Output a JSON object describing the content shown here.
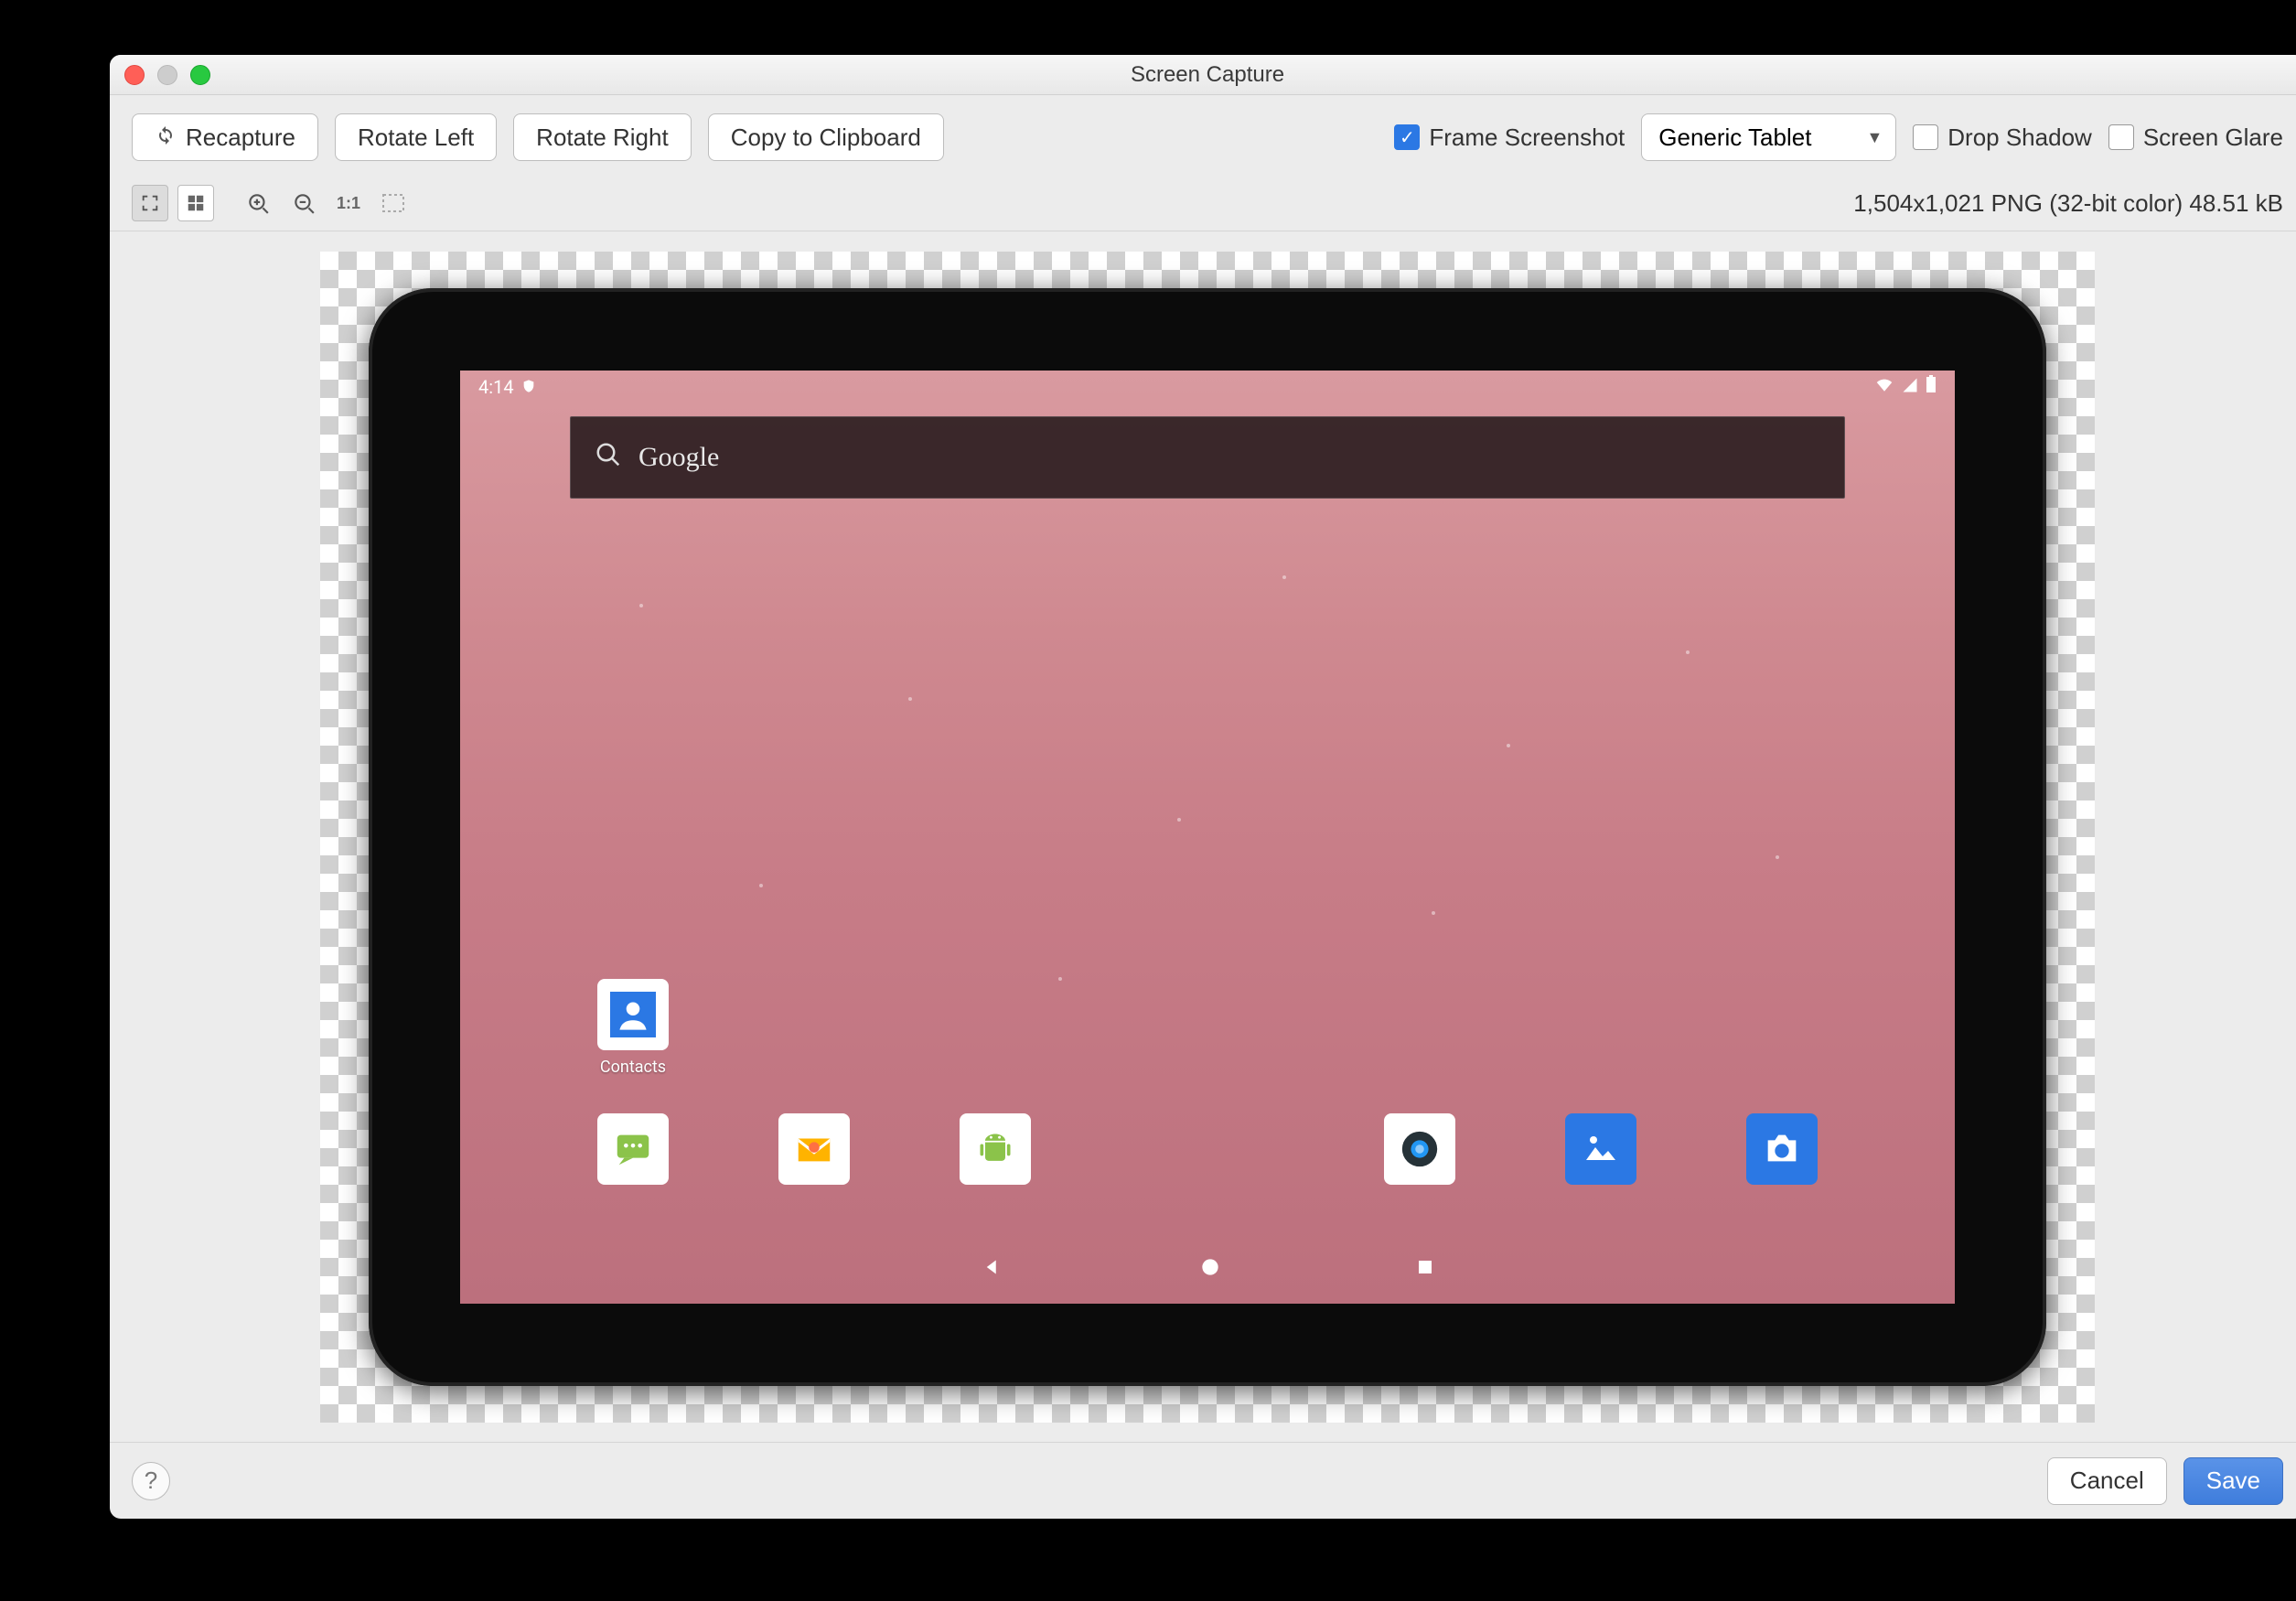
{
  "window": {
    "title": "Screen Capture"
  },
  "toolbar": {
    "recapture": "Recapture",
    "rotate_left": "Rotate Left",
    "rotate_right": "Rotate Right",
    "copy": "Copy to Clipboard",
    "frame_screenshot": "Frame Screenshot",
    "frame_screenshot_checked": true,
    "device_select": "Generic Tablet",
    "drop_shadow": "Drop Shadow",
    "drop_shadow_checked": false,
    "screen_glare": "Screen Glare",
    "screen_glare_checked": false
  },
  "zoombar": {
    "one_to_one": "1:1"
  },
  "image_info": "1,504x1,021 PNG (32-bit color) 48.51 kB",
  "device": {
    "statusbar": {
      "time": "4:14"
    },
    "search": {
      "placeholder": "Google"
    },
    "app_contacts": {
      "label": "Contacts"
    }
  },
  "footer": {
    "cancel": "Cancel",
    "save": "Save"
  }
}
